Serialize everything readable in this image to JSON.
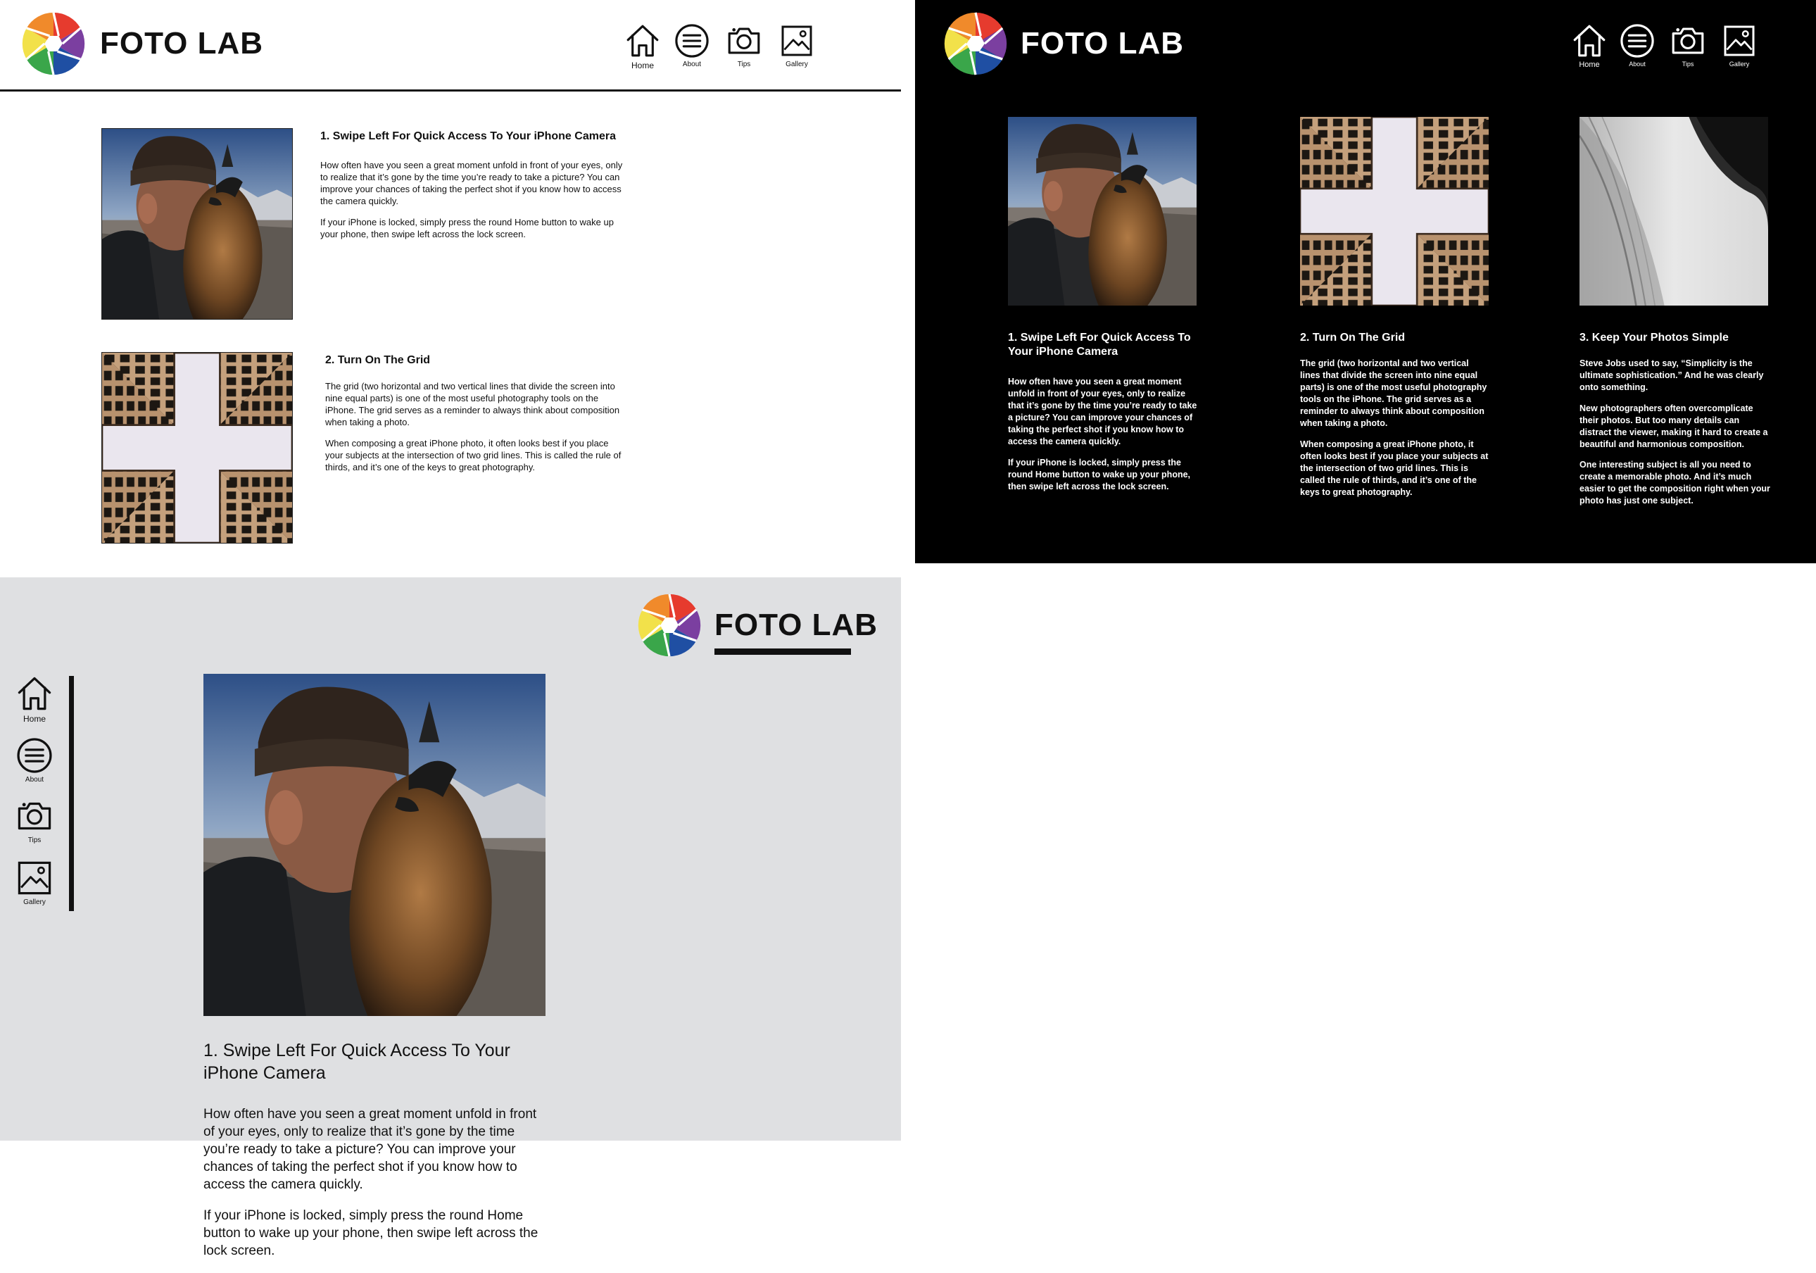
{
  "brand": {
    "name": "FOTO LAB"
  },
  "nav": {
    "home": "Home",
    "about": "About",
    "tips": "Tips",
    "gallery": "Gallery"
  },
  "tips": [
    {
      "title": "1. Swipe Left For Quick Access To Your iPhone Camera",
      "p1": "How often have you seen a great moment unfold in front of your eyes, only to realize that it’s gone by the time you’re ready to take a picture? You can improve your chances of taking the perfect shot if you know how to access the camera quickly.",
      "p2": "If your iPhone is locked, simply press the round Home button to wake up your phone, then swipe left across the lock screen."
    },
    {
      "title": "2. Turn On The Grid",
      "p1": "The grid (two horizontal and two vertical lines that divide the screen into nine equal parts) is one of the most useful photography tools on the iPhone. The grid serves as a reminder to always think about composition when taking a photo.",
      "p2": "When composing a great iPhone photo, it often looks best if you place your subjects at the intersection of two grid lines. This is called the rule of thirds, and it’s one of the keys to great photography."
    },
    {
      "title": "3. Keep Your Photos Simple",
      "p1": "Steve Jobs used to say, “Simplicity is the ultimate sophistication.” And he was clearly onto something.",
      "p2": "New photographers often overcomplicate their photos. But too many details can distract the viewer, making it hard to create a beautiful and harmonious composition.",
      "p3": "One interesting subject is all you need to create a memorable photo. And it’s much easier to get the composition right when your photo has just one subject."
    }
  ],
  "colors": {
    "light_bg": "#ffffff",
    "dark_bg": "#000000",
    "gray_bg": "#dfe0e2",
    "aperture": [
      "#e63b2e",
      "#7b3fa0",
      "#1f4fa3",
      "#3aa64a",
      "#f2e14a",
      "#f08a2b"
    ]
  },
  "icons": [
    "home-icon",
    "menu-icon",
    "camera-icon",
    "gallery-icon",
    "aperture-logo-icon"
  ]
}
